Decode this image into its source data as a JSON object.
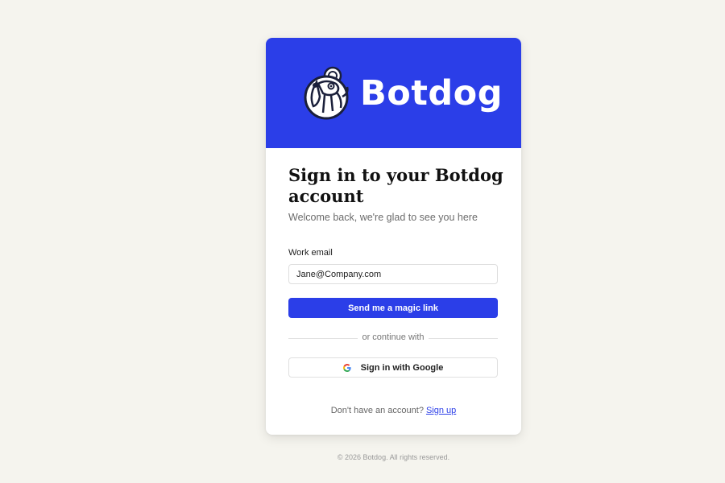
{
  "brand": {
    "name": "Botdog",
    "logo_icon": "dog-mascot-icon",
    "primary_color": "#2b3ee8"
  },
  "signin": {
    "title": "Sign in to your Botdog account",
    "subtitle": "Welcome back, we're glad to see you here",
    "email_label": "Work email",
    "email_value": "Jane@Company.com",
    "magic_link_button": "Send me a magic link",
    "divider_text": "or continue with",
    "google_button": "Sign in with Google",
    "google_icon": "google-icon",
    "no_account_text": "Don't have an account?",
    "signup_link": "Sign up"
  },
  "footer": {
    "copyright": "© 2026 Botdog. All rights reserved."
  }
}
